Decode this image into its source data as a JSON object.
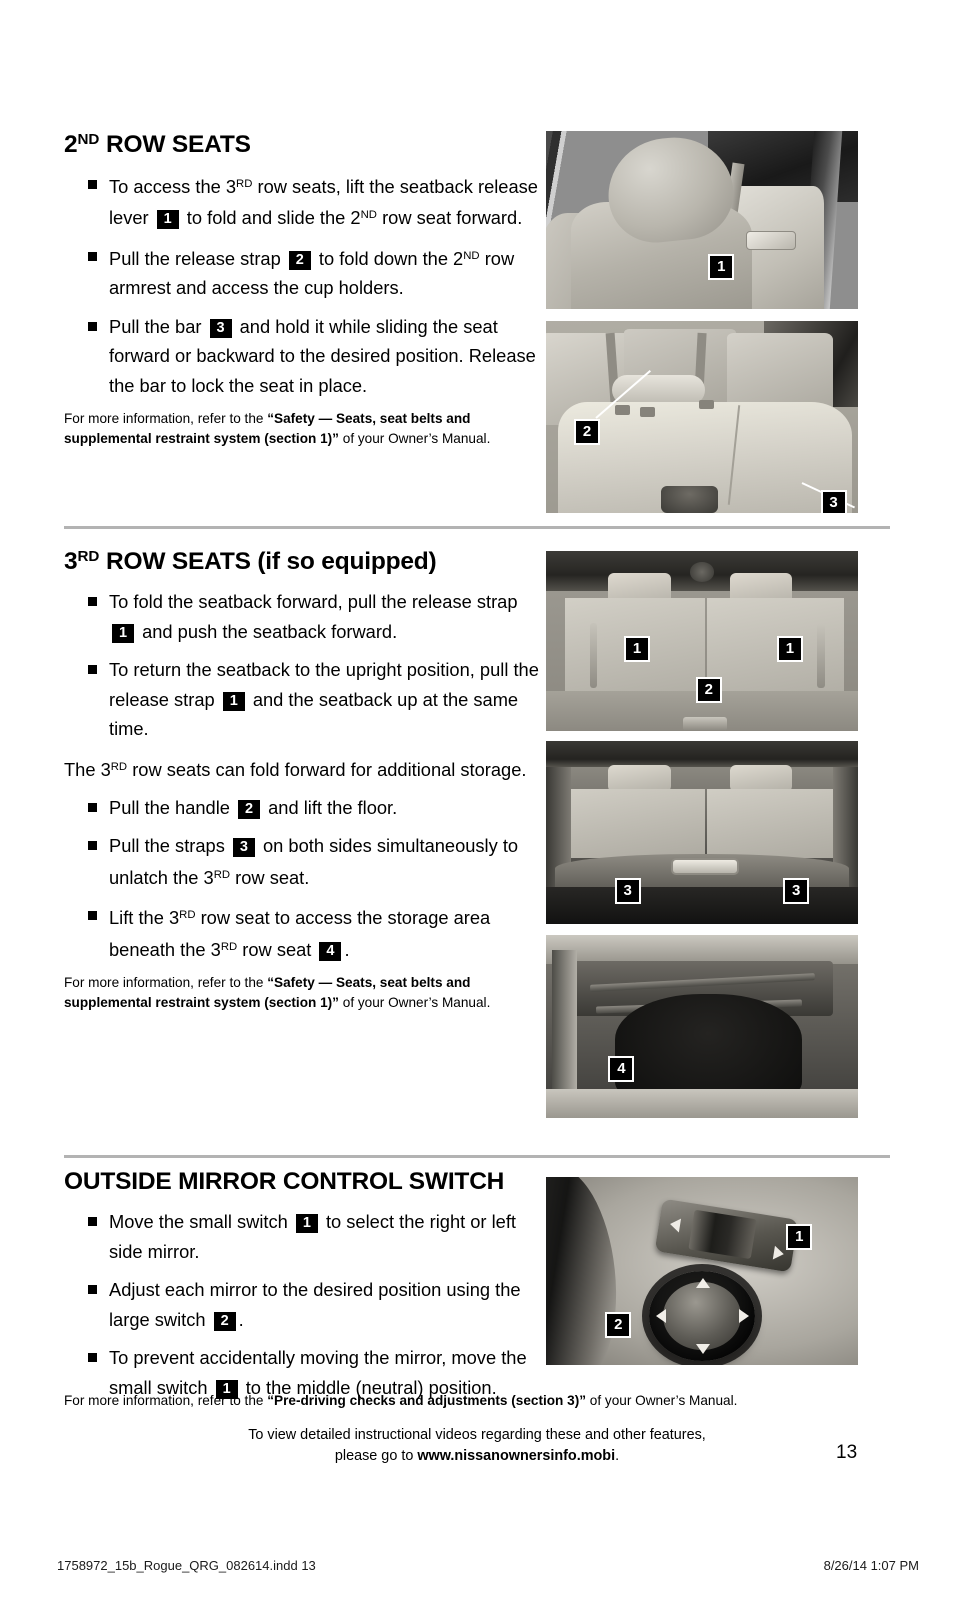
{
  "sections": [
    {
      "id": "second-row-seats",
      "title_pre": "2",
      "title_sup": "ND",
      "title_post": " ROW SEATS",
      "bullets": [
        {
          "parts": [
            {
              "t": "To access the 3"
            },
            {
              "sup": "RD"
            },
            {
              "t": " row seats, lift the seatback release lever "
            },
            {
              "chip": "1"
            },
            {
              "t": " to fold and slide the 2"
            },
            {
              "sup": "ND"
            },
            {
              "t": " row seat forward."
            }
          ]
        },
        {
          "parts": [
            {
              "t": "Pull the release strap "
            },
            {
              "chip": "2"
            },
            {
              "t": " to fold down the 2"
            },
            {
              "sup": "ND"
            },
            {
              "t": " row armrest and access the cup holders."
            }
          ]
        },
        {
          "parts": [
            {
              "t": "Pull the bar "
            },
            {
              "chip": "3"
            },
            {
              "t": " and hold it while sliding the seat forward or backward to the desired position. Release the bar to lock the seat in place."
            }
          ]
        }
      ],
      "note": {
        "lead": "For more information, refer to the ",
        "bold": "“Safety — Seats, seat belts and supplemental restraint system (section 1)”",
        "tail": " of your Owner’s Manual."
      }
    },
    {
      "id": "third-row-seats",
      "title_pre": "3",
      "title_sup": "RD",
      "title_post": " ROW SEATS (if so equipped)",
      "bullets": [
        {
          "parts": [
            {
              "t": "To fold the seatback forward, pull the release strap "
            },
            {
              "chip": "1"
            },
            {
              "t": " and push the seatback forward."
            }
          ]
        },
        {
          "parts": [
            {
              "t": "To return the seatback to the upright position, pull the release strap "
            },
            {
              "chip": "1"
            },
            {
              "t": " and the seatback up at the same time."
            }
          ]
        }
      ],
      "middle_paragraph": {
        "parts": [
          {
            "t": "The 3"
          },
          {
            "sup": "RD"
          },
          {
            "t": " row seats can fold forward for additional storage."
          }
        ]
      },
      "bullets2": [
        {
          "parts": [
            {
              "t": "Pull the handle "
            },
            {
              "chip": "2"
            },
            {
              "t": " and lift the floor."
            }
          ]
        },
        {
          "parts": [
            {
              "t": "Pull the straps "
            },
            {
              "chip": "3"
            },
            {
              "t": " on both sides simultaneously to unlatch the 3"
            },
            {
              "sup": "RD"
            },
            {
              "t": " row seat."
            }
          ]
        },
        {
          "parts": [
            {
              "t": "Lift the 3"
            },
            {
              "sup": "RD"
            },
            {
              "t": " row seat to access the storage area beneath the 3"
            },
            {
              "sup": "RD"
            },
            {
              "t": " row seat "
            },
            {
              "chip": "4"
            },
            {
              "t": "."
            }
          ]
        }
      ],
      "note": {
        "lead": "For more information, refer to the ",
        "bold": "“Safety — Seats, seat belts and supplemental restraint system (section 1)”",
        "tail": " of your Owner’s Manual."
      }
    },
    {
      "id": "outside-mirror-control-switch",
      "title_pre": "",
      "title_sup": "",
      "title_post": "OUTSIDE MIRROR CONTROL SWITCH",
      "bullets": [
        {
          "parts": [
            {
              "t": "Move the small switch "
            },
            {
              "chip": "1"
            },
            {
              "t": " to select the right or left side mirror."
            }
          ]
        },
        {
          "parts": [
            {
              "t": "Adjust each mirror to the desired position using the large switch "
            },
            {
              "chip": "2"
            },
            {
              "t": "."
            }
          ]
        },
        {
          "parts": [
            {
              "t": "To prevent accidentally moving the mirror, move the small switch "
            },
            {
              "chip": "1"
            },
            {
              "t": " to the middle (neutral) position."
            }
          ]
        }
      ],
      "note": {
        "lead": "For more information, refer to the ",
        "bold": "“Pre-driving checks and adjustments (section 3)”",
        "tail": " of your Owner’s Manual."
      }
    }
  ],
  "photos": [
    {
      "id": "photo-2nd-row-seatback",
      "callouts": [
        "1"
      ]
    },
    {
      "id": "photo-2nd-row-bench",
      "callouts": [
        "2",
        "3"
      ]
    },
    {
      "id": "photo-3rd-row-seats",
      "callouts": [
        "1",
        "1",
        "2"
      ]
    },
    {
      "id": "photo-cargo-floor-handle",
      "callouts": [
        "3",
        "3"
      ]
    },
    {
      "id": "photo-underfloor-storage",
      "callouts": [
        "4"
      ]
    },
    {
      "id": "photo-mirror-switch",
      "callouts": [
        "1",
        "2"
      ]
    }
  ],
  "footer": {
    "video_line1": "To view detailed instructional videos regarding these and other features,",
    "video_line2_pre": "please go to ",
    "video_line2_url": "www.nissanownersinfo.mobi",
    "video_line2_post": ".",
    "page_number": "13",
    "print_file": "1758972_15b_Rogue_QRG_082614.indd   13",
    "print_stamp": "8/26/14   1:07 PM"
  },
  "colors": {
    "rule": "#b3b3b3",
    "chip_bg": "#000000",
    "chip_fg": "#ffffff"
  }
}
